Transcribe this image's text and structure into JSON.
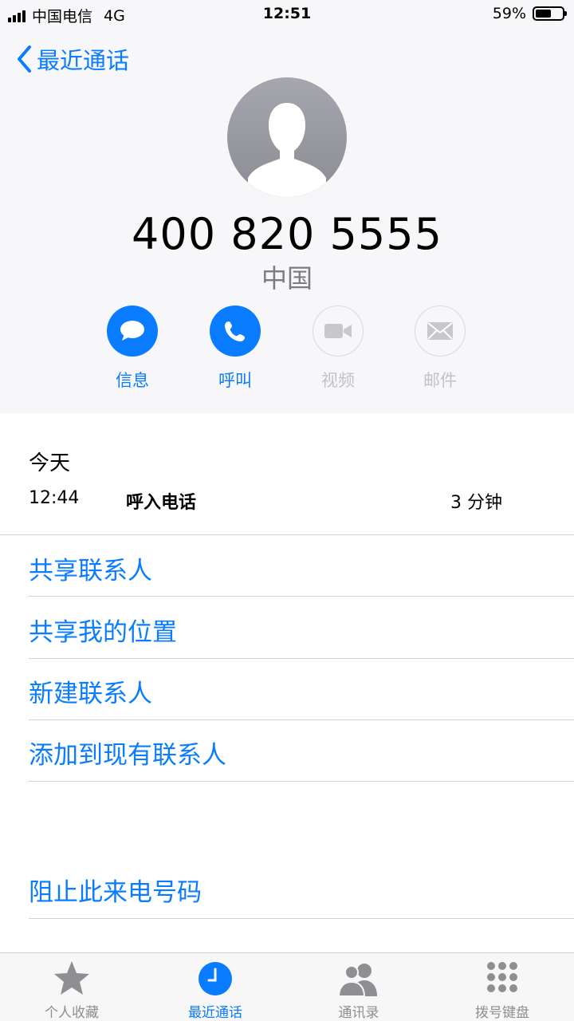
{
  "status_bar": {
    "carrier": "中国电信",
    "network": "4G",
    "time": "12:51",
    "battery_percent": "59%",
    "battery_level": 0.59
  },
  "nav": {
    "back_label": "最近通话"
  },
  "contact": {
    "number": "400 820 5555",
    "region": "中国"
  },
  "actions": [
    {
      "label": "信息",
      "enabled": true,
      "icon": "message-bubble-icon"
    },
    {
      "label": "呼叫",
      "enabled": true,
      "icon": "phone-icon"
    },
    {
      "label": "视频",
      "enabled": false,
      "icon": "video-camera-icon"
    },
    {
      "label": "邮件",
      "enabled": false,
      "icon": "envelope-icon"
    }
  ],
  "call_log": {
    "day": "今天",
    "entries": [
      {
        "time": "12:44",
        "type": "呼入电话",
        "duration": "3 分钟"
      }
    ]
  },
  "options": {
    "share_contact": "共享联系人",
    "share_location": "共享我的位置",
    "new_contact": "新建联系人",
    "add_to_existing": "添加到现有联系人",
    "block": "阻止此来电号码"
  },
  "tabs": [
    {
      "label": "个人收藏",
      "icon": "star-icon",
      "selected": false
    },
    {
      "label": "最近通话",
      "icon": "clock-icon",
      "selected": true
    },
    {
      "label": "通讯录",
      "icon": "contacts-icon",
      "selected": false
    },
    {
      "label": "拨号键盘",
      "icon": "keypad-icon",
      "selected": false
    }
  ],
  "colors": {
    "accent": "#0a7cff",
    "disabled": "#c2c2c7",
    "header_bg": "#f7f7f9"
  }
}
